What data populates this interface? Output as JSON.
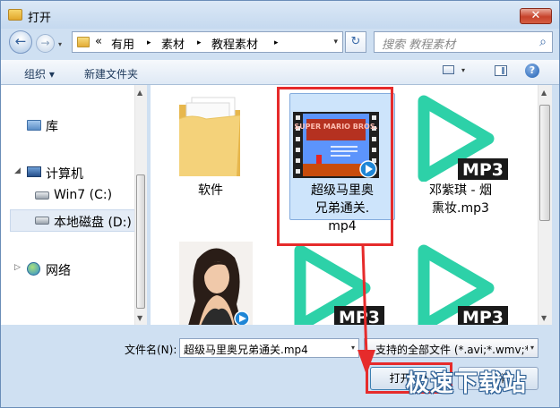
{
  "window": {
    "title": "打开",
    "close": "✕"
  },
  "nav": {
    "back_glyph": "←",
    "forward_glyph": "→",
    "dropdown_glyph": "▾",
    "breadcrumb": [
      "«",
      "有用",
      "▸",
      "素材",
      "▸",
      "教程素材",
      "▸"
    ],
    "refresh_glyph": "↻",
    "search_placeholder": "搜索 教程素材",
    "search_icon": "⌕"
  },
  "toolbar": {
    "organize": "组织 ▾",
    "new_folder": "新建文件夹",
    "help": "?",
    "view_dd": "▾"
  },
  "sidebar": {
    "items": [
      {
        "label": "库",
        "icon": "library-icon"
      },
      {
        "label": "计算机",
        "icon": "computer-icon"
      },
      {
        "label": "Win7 (C:)",
        "icon": "drive-icon"
      },
      {
        "label": "本地磁盘 (D:)",
        "icon": "drive-icon"
      },
      {
        "label": "网络",
        "icon": "network-icon"
      }
    ],
    "tri_closed": "▷",
    "tri_open": "◢"
  },
  "files": [
    {
      "name": "软件",
      "type": "folder"
    },
    {
      "name": "超级马里奥兄弟通关.mp4",
      "line1": "超级马里奥",
      "line2": "兄弟通关.",
      "line3": "mp4",
      "type": "video",
      "selected": true
    },
    {
      "name": "邓紫琪 - 烟熏妆.mp3",
      "line1": "邓紫琪 - 烟",
      "line2": "熏妆.mp3",
      "type": "mp3"
    },
    {
      "name": "",
      "type": "video-photo"
    },
    {
      "name": "",
      "type": "mp3"
    },
    {
      "name": "",
      "type": "mp3"
    }
  ],
  "badges": {
    "mp3": "MP3",
    "mario": "SUPER MARIO BROS."
  },
  "bottom": {
    "filename_label": "文件名(N):",
    "filename_value": "超级马里奥兄弟通关.mp4",
    "filetype_value": "支持的全部文件 (*.avi;*.wmv;*.",
    "open_label": "打开(O)",
    "cancel_label": "取消",
    "watermark": "极速下载站"
  },
  "colors": {
    "play": "#2dd1a8",
    "highlight": "#e62b2b",
    "selection": "#cde4fb"
  }
}
